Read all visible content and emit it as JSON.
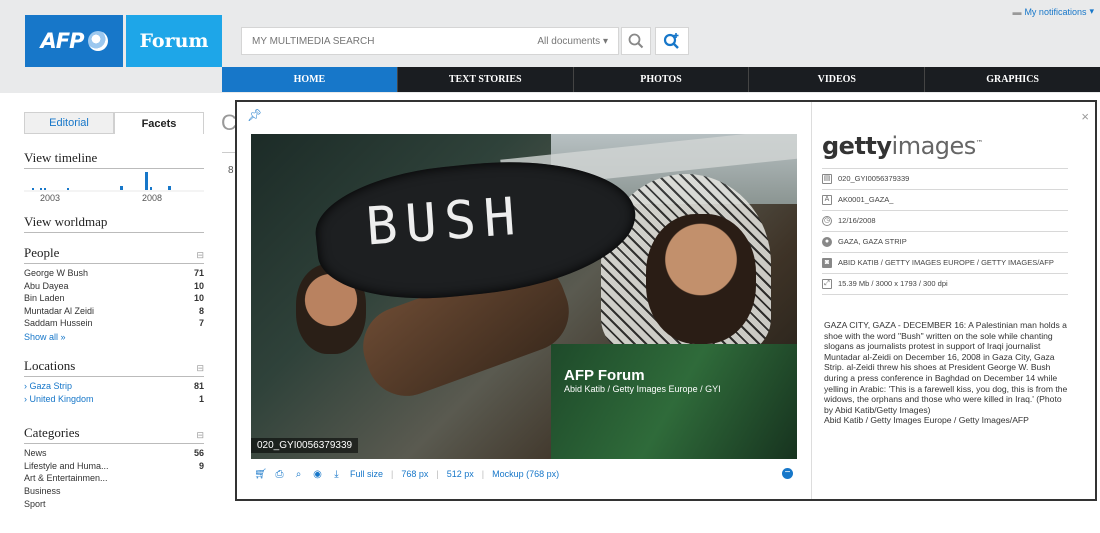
{
  "header": {
    "logo_afp": "AFP",
    "logo_forum": "Forum",
    "search_placeholder": "MY MULTIMEDIA SEARCH",
    "search_scope": "All documents",
    "notifications_label": "My notifications"
  },
  "nav": {
    "tabs": [
      "HOME",
      "TEXT STORIES",
      "PHOTOS",
      "VIDEOS",
      "GRAPHICS"
    ]
  },
  "sidebar": {
    "tabs": [
      "Editorial",
      "Facets"
    ],
    "timeline_title": "View timeline",
    "timeline_years": [
      "2003",
      "2008"
    ],
    "worldmap_title": "View worldmap",
    "people": {
      "title": "People",
      "items": [
        {
          "label": "George W Bush",
          "count": "71"
        },
        {
          "label": "Abu Dayea",
          "count": "10"
        },
        {
          "label": "Bin Laden",
          "count": "10"
        },
        {
          "label": "Muntadar Al Zeidi",
          "count": "8"
        },
        {
          "label": "Saddam Hussein",
          "count": "7"
        }
      ],
      "show_all": "Show all »"
    },
    "locations": {
      "title": "Locations",
      "items": [
        {
          "label": "Gaza Strip",
          "count": "81"
        },
        {
          "label": "United Kingdom",
          "count": "1"
        }
      ]
    },
    "categories": {
      "title": "Categories",
      "items": [
        {
          "label": "News",
          "count": "56"
        },
        {
          "label": "Lifestyle and Huma...",
          "count": "9"
        },
        {
          "label": "Art & Entertainmen...",
          "count": ""
        },
        {
          "label": "Business",
          "count": ""
        },
        {
          "label": "Sport",
          "count": ""
        }
      ]
    }
  },
  "background": {
    "title_letter": "C",
    "result_count": "8"
  },
  "modal": {
    "photo_sole_text": "BUSH",
    "watermark_title": "AFP Forum",
    "watermark_credit": "Abid Katib / Getty Images Europe / GYI",
    "photo_id": "020_GYI0056379339",
    "toolbar": {
      "full_size": "Full size",
      "size_768": "768 px",
      "size_512": "512 px",
      "mockup": "Mockup (768 px)"
    },
    "info": {
      "logo_bold": "getty",
      "logo_light": "images",
      "id": "020_GYI0056379339",
      "slug": "AK0001_GAZA_",
      "date": "12/16/2008",
      "location": "GAZA, GAZA STRIP",
      "credit": "ABID KATIB / GETTY IMAGES EUROPE / GETTY IMAGES/AFP",
      "file_info": "15.39 Mb / 3000 x 1793 / 300 dpi",
      "caption": "GAZA CITY, GAZA - DECEMBER 16: A Palestinian man holds a shoe with the word \"Bush\" written on the sole while chanting slogans as journalists protest in support of Iraqi journalist Muntadar al-Zeidi on December 16, 2008 in Gaza City, Gaza Strip. al-Zeidi threw his shoes at President George W. Bush during a press conference in Baghdad on December 14 while yelling in Arabic: 'This is a farewell kiss, you dog, this is from the widows, the orphans and those who were killed in Iraq.' (Photo by Abid Katib/Getty Images)",
      "caption_credit": "Abid Katib / Getty Images Europe / Getty Images/AFP"
    }
  },
  "colors": {
    "brand_blue": "#1777c9",
    "forum_blue": "#1ea6e8",
    "nav_dark": "#1a1d21"
  }
}
